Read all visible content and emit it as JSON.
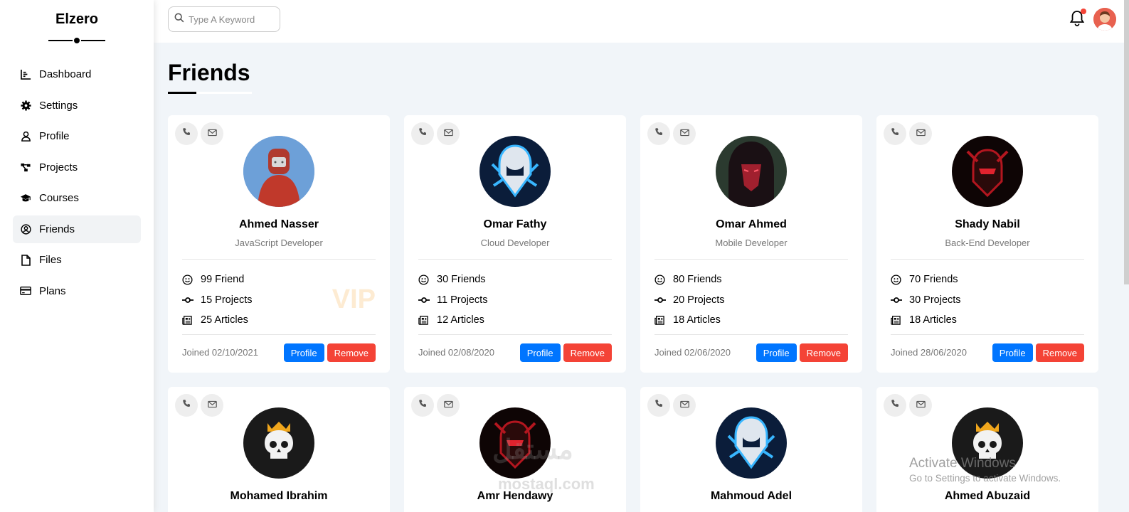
{
  "brand": "Elzero",
  "nav": [
    {
      "label": "Dashboard",
      "icon": "chart-icon"
    },
    {
      "label": "Settings",
      "icon": "gear-icon"
    },
    {
      "label": "Profile",
      "icon": "user-icon"
    },
    {
      "label": "Projects",
      "icon": "diagram-icon"
    },
    {
      "label": "Courses",
      "icon": "graduation-cap-icon"
    },
    {
      "label": "Friends",
      "icon": "user-circle-icon",
      "active": true
    },
    {
      "label": "Files",
      "icon": "file-icon"
    },
    {
      "label": "Plans",
      "icon": "credit-card-icon"
    }
  ],
  "search": {
    "placeholder": "Type A Keyword"
  },
  "page_title": "Friends",
  "cards": [
    {
      "name": "Ahmed Nasser",
      "role": "JavaScript Developer",
      "friends": "99 Friend",
      "projects": "15 Projects",
      "articles": "25 Articles",
      "joined": "Joined 02/10/2021",
      "vip": "VIP",
      "avatar_color": "#c0392b"
    },
    {
      "name": "Omar Fathy",
      "role": "Cloud Developer",
      "friends": "30 Friends",
      "projects": "11 Projects",
      "articles": "12 Articles",
      "joined": "Joined 02/08/2020",
      "avatar_color": "#0b1d3a"
    },
    {
      "name": "Omar Ahmed",
      "role": "Mobile Developer",
      "friends": "80 Friends",
      "projects": "20 Projects",
      "articles": "18 Articles",
      "joined": "Joined 02/06/2020",
      "avatar_color": "#3a1a1f"
    },
    {
      "name": "Shady Nabil",
      "role": "Back-End Developer",
      "friends": "70 Friends",
      "projects": "30 Projects",
      "articles": "18 Articles",
      "joined": "Joined 28/06/2020",
      "avatar_color": "#120808"
    },
    {
      "name": "Mohamed Ibrahim",
      "avatar_color": "#1a1a1a"
    },
    {
      "name": "Amr Hendawy",
      "avatar_color": "#1a0808"
    },
    {
      "name": "Mahmoud Adel",
      "avatar_color": "#0b1d3a"
    },
    {
      "name": "Ahmed Abuzaid",
      "avatar_color": "#1a1a1a"
    }
  ],
  "buttons": {
    "profile": "Profile",
    "remove": "Remove"
  },
  "watermark": {
    "arabic": "مستقل",
    "latin": "mostaql.com"
  },
  "activate_windows": {
    "title": "Activate Windows",
    "subtitle": "Go to Settings to activate Windows."
  },
  "colors": {
    "primary": "#0075ff",
    "danger": "#f44336",
    "background": "#f1f5f9"
  }
}
